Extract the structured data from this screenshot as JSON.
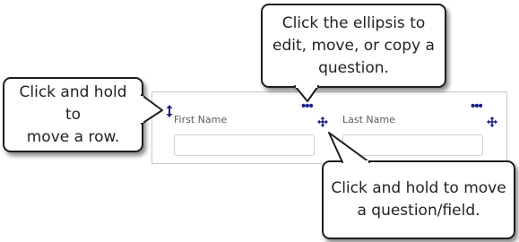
{
  "form_row": {
    "fields": [
      {
        "label": "First Name",
        "value": "",
        "placeholder": ""
      },
      {
        "label": "Last Name",
        "value": "",
        "placeholder": ""
      }
    ],
    "ellipsis_label": "•••"
  },
  "callouts": {
    "ellipsis": "Click the ellipsis to\nedit, move, or copy a\nquestion.",
    "row": "Click and hold to\nmove a row.",
    "field": "Click and hold to move\na question/field."
  },
  "icons": {
    "row_move": "vertical-arrow-icon",
    "field_move": "four-way-move-icon",
    "ellipsis": "ellipsis-icon"
  },
  "colors": {
    "accent": "#1a1f8c",
    "callout_border": "#1e1e1e",
    "row_border": "#c9c9c9",
    "label_text": "#5a5a5a"
  }
}
